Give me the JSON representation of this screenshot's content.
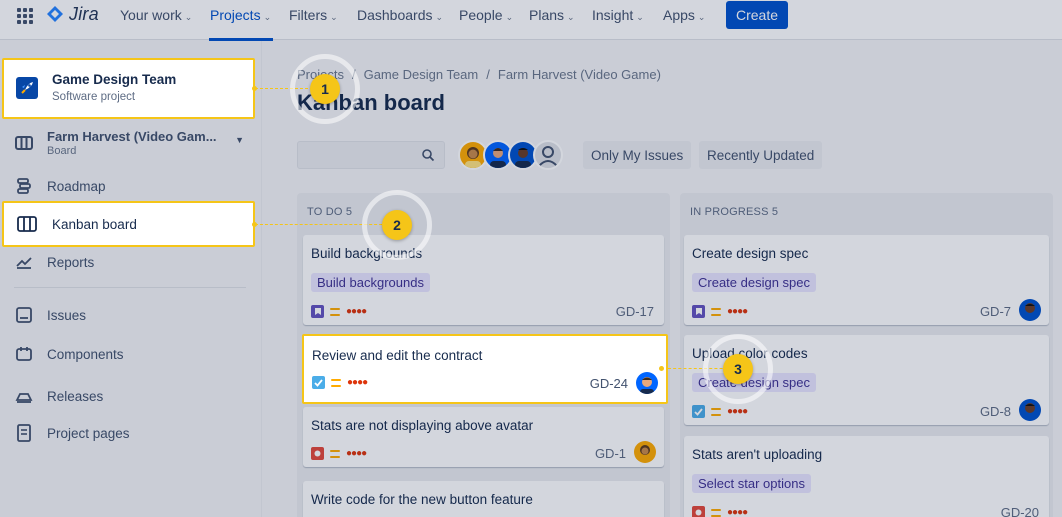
{
  "brand": {
    "name": "Jira"
  },
  "nav": {
    "items": [
      {
        "label": "Your work"
      },
      {
        "label": "Projects"
      },
      {
        "label": "Filters"
      },
      {
        "label": "Dashboards"
      },
      {
        "label": "People"
      },
      {
        "label": "Plans"
      },
      {
        "label": "Insight"
      },
      {
        "label": "Apps"
      }
    ],
    "create_label": "Create"
  },
  "sidebar": {
    "project": {
      "name": "Game Design Team",
      "type": "Software project"
    },
    "board_switcher": {
      "name": "Farm Harvest (Video Gam...",
      "sub": "Board"
    },
    "items": [
      {
        "label": "Roadmap",
        "icon": "roadmap-icon"
      },
      {
        "label": "Kanban board",
        "icon": "board-icon"
      },
      {
        "label": "Reports",
        "icon": "reports-icon"
      },
      {
        "label": "Issues",
        "icon": "issues-icon"
      },
      {
        "label": "Components",
        "icon": "components-icon"
      },
      {
        "label": "Releases",
        "icon": "releases-icon"
      },
      {
        "label": "Project pages",
        "icon": "pages-icon"
      }
    ]
  },
  "main": {
    "breadcrumb": [
      "Projects",
      "Game Design Team",
      "Farm Harvest (Video Game)"
    ],
    "title": "Kanban board",
    "search": {
      "value": "",
      "placeholder": ""
    },
    "filters": {
      "only_mine": "Only My Issues",
      "recent": "Recently Updated"
    },
    "columns": [
      {
        "header": "TO DO 5",
        "cards": [
          {
            "title": "Build backgrounds",
            "epic": "Build backgrounds",
            "key": "GD-17",
            "type": "story"
          },
          {
            "title": "Review and edit the contract",
            "key": "GD-24",
            "type": "task"
          },
          {
            "title": "Stats are not displaying above avatar",
            "key": "GD-1",
            "type": "bug"
          },
          {
            "title": "Write code for the new button feature"
          }
        ]
      },
      {
        "header": "IN PROGRESS 5",
        "cards": [
          {
            "title": "Create design spec",
            "epic": "Create design spec",
            "key": "GD-7",
            "type": "story"
          },
          {
            "title": "Upload color codes",
            "epic": "Create design spec",
            "key": "GD-8",
            "type": "task"
          },
          {
            "title": "Stats aren't uploading",
            "epic": "Select star options",
            "key": "GD-20",
            "type": "bug"
          }
        ]
      }
    ]
  },
  "callouts": [
    "1",
    "2",
    "3"
  ],
  "colors": {
    "accent": "#0052cc",
    "highlight": "#f5c518",
    "epic_bg": "#eae6ff",
    "epic_text": "#403294"
  }
}
